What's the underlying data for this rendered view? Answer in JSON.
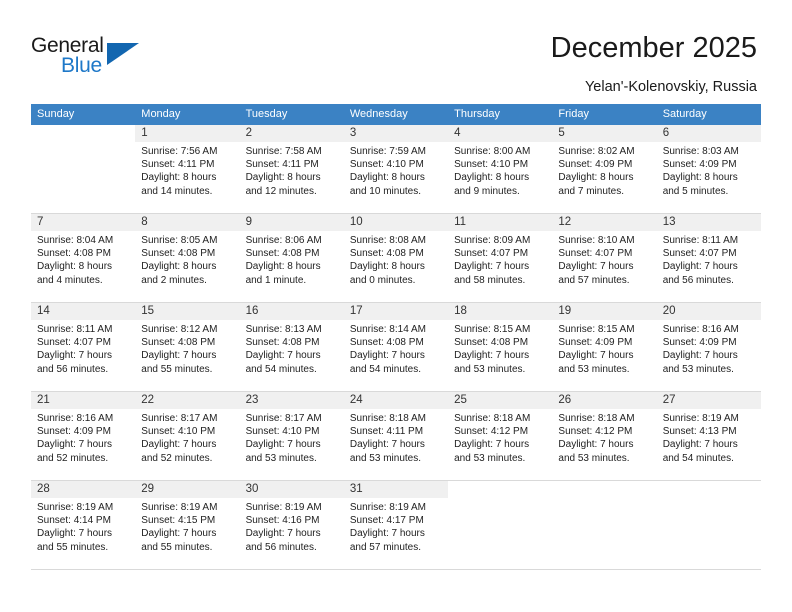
{
  "brand": {
    "word_one": "General",
    "word_two": "Blue",
    "triangle_color": "#1266b0",
    "blue_color": "#1e78c8"
  },
  "header": {
    "title": "December 2025",
    "location": "Yelan'-Kolenovskiy, Russia"
  },
  "theme": {
    "header_row_bg": "#3b82c4",
    "daynum_band_bg": "#f0f0f0",
    "row_border": "#d9d9d9"
  },
  "weekdays": [
    "Sunday",
    "Monday",
    "Tuesday",
    "Wednesday",
    "Thursday",
    "Friday",
    "Saturday"
  ],
  "weeks": [
    [
      {
        "day": "",
        "sunrise": "",
        "sunset": "",
        "daylight_1": "",
        "daylight_2": ""
      },
      {
        "day": "1",
        "sunrise": "Sunrise: 7:56 AM",
        "sunset": "Sunset: 4:11 PM",
        "daylight_1": "Daylight: 8 hours",
        "daylight_2": "and 14 minutes."
      },
      {
        "day": "2",
        "sunrise": "Sunrise: 7:58 AM",
        "sunset": "Sunset: 4:11 PM",
        "daylight_1": "Daylight: 8 hours",
        "daylight_2": "and 12 minutes."
      },
      {
        "day": "3",
        "sunrise": "Sunrise: 7:59 AM",
        "sunset": "Sunset: 4:10 PM",
        "daylight_1": "Daylight: 8 hours",
        "daylight_2": "and 10 minutes."
      },
      {
        "day": "4",
        "sunrise": "Sunrise: 8:00 AM",
        "sunset": "Sunset: 4:10 PM",
        "daylight_1": "Daylight: 8 hours",
        "daylight_2": "and 9 minutes."
      },
      {
        "day": "5",
        "sunrise": "Sunrise: 8:02 AM",
        "sunset": "Sunset: 4:09 PM",
        "daylight_1": "Daylight: 8 hours",
        "daylight_2": "and 7 minutes."
      },
      {
        "day": "6",
        "sunrise": "Sunrise: 8:03 AM",
        "sunset": "Sunset: 4:09 PM",
        "daylight_1": "Daylight: 8 hours",
        "daylight_2": "and 5 minutes."
      }
    ],
    [
      {
        "day": "7",
        "sunrise": "Sunrise: 8:04 AM",
        "sunset": "Sunset: 4:08 PM",
        "daylight_1": "Daylight: 8 hours",
        "daylight_2": "and 4 minutes."
      },
      {
        "day": "8",
        "sunrise": "Sunrise: 8:05 AM",
        "sunset": "Sunset: 4:08 PM",
        "daylight_1": "Daylight: 8 hours",
        "daylight_2": "and 2 minutes."
      },
      {
        "day": "9",
        "sunrise": "Sunrise: 8:06 AM",
        "sunset": "Sunset: 4:08 PM",
        "daylight_1": "Daylight: 8 hours",
        "daylight_2": "and 1 minute."
      },
      {
        "day": "10",
        "sunrise": "Sunrise: 8:08 AM",
        "sunset": "Sunset: 4:08 PM",
        "daylight_1": "Daylight: 8 hours",
        "daylight_2": "and 0 minutes."
      },
      {
        "day": "11",
        "sunrise": "Sunrise: 8:09 AM",
        "sunset": "Sunset: 4:07 PM",
        "daylight_1": "Daylight: 7 hours",
        "daylight_2": "and 58 minutes."
      },
      {
        "day": "12",
        "sunrise": "Sunrise: 8:10 AM",
        "sunset": "Sunset: 4:07 PM",
        "daylight_1": "Daylight: 7 hours",
        "daylight_2": "and 57 minutes."
      },
      {
        "day": "13",
        "sunrise": "Sunrise: 8:11 AM",
        "sunset": "Sunset: 4:07 PM",
        "daylight_1": "Daylight: 7 hours",
        "daylight_2": "and 56 minutes."
      }
    ],
    [
      {
        "day": "14",
        "sunrise": "Sunrise: 8:11 AM",
        "sunset": "Sunset: 4:07 PM",
        "daylight_1": "Daylight: 7 hours",
        "daylight_2": "and 56 minutes."
      },
      {
        "day": "15",
        "sunrise": "Sunrise: 8:12 AM",
        "sunset": "Sunset: 4:08 PM",
        "daylight_1": "Daylight: 7 hours",
        "daylight_2": "and 55 minutes."
      },
      {
        "day": "16",
        "sunrise": "Sunrise: 8:13 AM",
        "sunset": "Sunset: 4:08 PM",
        "daylight_1": "Daylight: 7 hours",
        "daylight_2": "and 54 minutes."
      },
      {
        "day": "17",
        "sunrise": "Sunrise: 8:14 AM",
        "sunset": "Sunset: 4:08 PM",
        "daylight_1": "Daylight: 7 hours",
        "daylight_2": "and 54 minutes."
      },
      {
        "day": "18",
        "sunrise": "Sunrise: 8:15 AM",
        "sunset": "Sunset: 4:08 PM",
        "daylight_1": "Daylight: 7 hours",
        "daylight_2": "and 53 minutes."
      },
      {
        "day": "19",
        "sunrise": "Sunrise: 8:15 AM",
        "sunset": "Sunset: 4:09 PM",
        "daylight_1": "Daylight: 7 hours",
        "daylight_2": "and 53 minutes."
      },
      {
        "day": "20",
        "sunrise": "Sunrise: 8:16 AM",
        "sunset": "Sunset: 4:09 PM",
        "daylight_1": "Daylight: 7 hours",
        "daylight_2": "and 53 minutes."
      }
    ],
    [
      {
        "day": "21",
        "sunrise": "Sunrise: 8:16 AM",
        "sunset": "Sunset: 4:09 PM",
        "daylight_1": "Daylight: 7 hours",
        "daylight_2": "and 52 minutes."
      },
      {
        "day": "22",
        "sunrise": "Sunrise: 8:17 AM",
        "sunset": "Sunset: 4:10 PM",
        "daylight_1": "Daylight: 7 hours",
        "daylight_2": "and 52 minutes."
      },
      {
        "day": "23",
        "sunrise": "Sunrise: 8:17 AM",
        "sunset": "Sunset: 4:10 PM",
        "daylight_1": "Daylight: 7 hours",
        "daylight_2": "and 53 minutes."
      },
      {
        "day": "24",
        "sunrise": "Sunrise: 8:18 AM",
        "sunset": "Sunset: 4:11 PM",
        "daylight_1": "Daylight: 7 hours",
        "daylight_2": "and 53 minutes."
      },
      {
        "day": "25",
        "sunrise": "Sunrise: 8:18 AM",
        "sunset": "Sunset: 4:12 PM",
        "daylight_1": "Daylight: 7 hours",
        "daylight_2": "and 53 minutes."
      },
      {
        "day": "26",
        "sunrise": "Sunrise: 8:18 AM",
        "sunset": "Sunset: 4:12 PM",
        "daylight_1": "Daylight: 7 hours",
        "daylight_2": "and 53 minutes."
      },
      {
        "day": "27",
        "sunrise": "Sunrise: 8:19 AM",
        "sunset": "Sunset: 4:13 PM",
        "daylight_1": "Daylight: 7 hours",
        "daylight_2": "and 54 minutes."
      }
    ],
    [
      {
        "day": "28",
        "sunrise": "Sunrise: 8:19 AM",
        "sunset": "Sunset: 4:14 PM",
        "daylight_1": "Daylight: 7 hours",
        "daylight_2": "and 55 minutes."
      },
      {
        "day": "29",
        "sunrise": "Sunrise: 8:19 AM",
        "sunset": "Sunset: 4:15 PM",
        "daylight_1": "Daylight: 7 hours",
        "daylight_2": "and 55 minutes."
      },
      {
        "day": "30",
        "sunrise": "Sunrise: 8:19 AM",
        "sunset": "Sunset: 4:16 PM",
        "daylight_1": "Daylight: 7 hours",
        "daylight_2": "and 56 minutes."
      },
      {
        "day": "31",
        "sunrise": "Sunrise: 8:19 AM",
        "sunset": "Sunset: 4:17 PM",
        "daylight_1": "Daylight: 7 hours",
        "daylight_2": "and 57 minutes."
      },
      {
        "day": "",
        "sunrise": "",
        "sunset": "",
        "daylight_1": "",
        "daylight_2": ""
      },
      {
        "day": "",
        "sunrise": "",
        "sunset": "",
        "daylight_1": "",
        "daylight_2": ""
      },
      {
        "day": "",
        "sunrise": "",
        "sunset": "",
        "daylight_1": "",
        "daylight_2": ""
      }
    ]
  ]
}
